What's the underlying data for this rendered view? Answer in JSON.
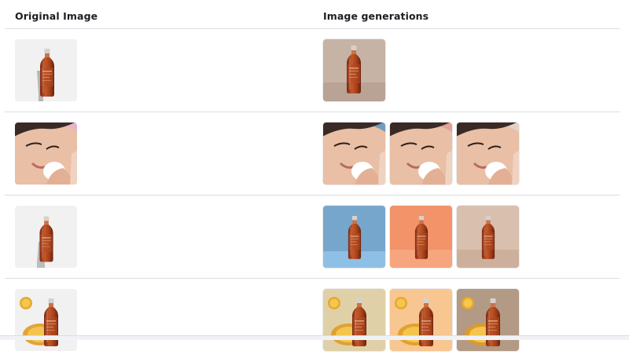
{
  "header": {
    "original_label": "Original Image",
    "generations_label": "Image generations"
  },
  "rows": [
    {
      "original": "bottle-on-grey",
      "generations": [
        "bottle-on-beige"
      ]
    },
    {
      "original": "face-pink",
      "generations": [
        "face-blue",
        "face-rose",
        "face-neutral"
      ]
    },
    {
      "original": "bottle-on-grey",
      "generations": [
        "bottle-on-blue",
        "bottle-on-orange",
        "bottle-on-tan"
      ]
    },
    {
      "original": "bottle-with-orange-slices",
      "generations": [
        "bottle-slices-cream",
        "bottle-slices-peach",
        "bottle-slices-brown"
      ]
    }
  ],
  "colors": {
    "divider": "#dadde1",
    "bottle_liquid": "#b3461f",
    "bottle_cap": "#d9d2cf"
  }
}
